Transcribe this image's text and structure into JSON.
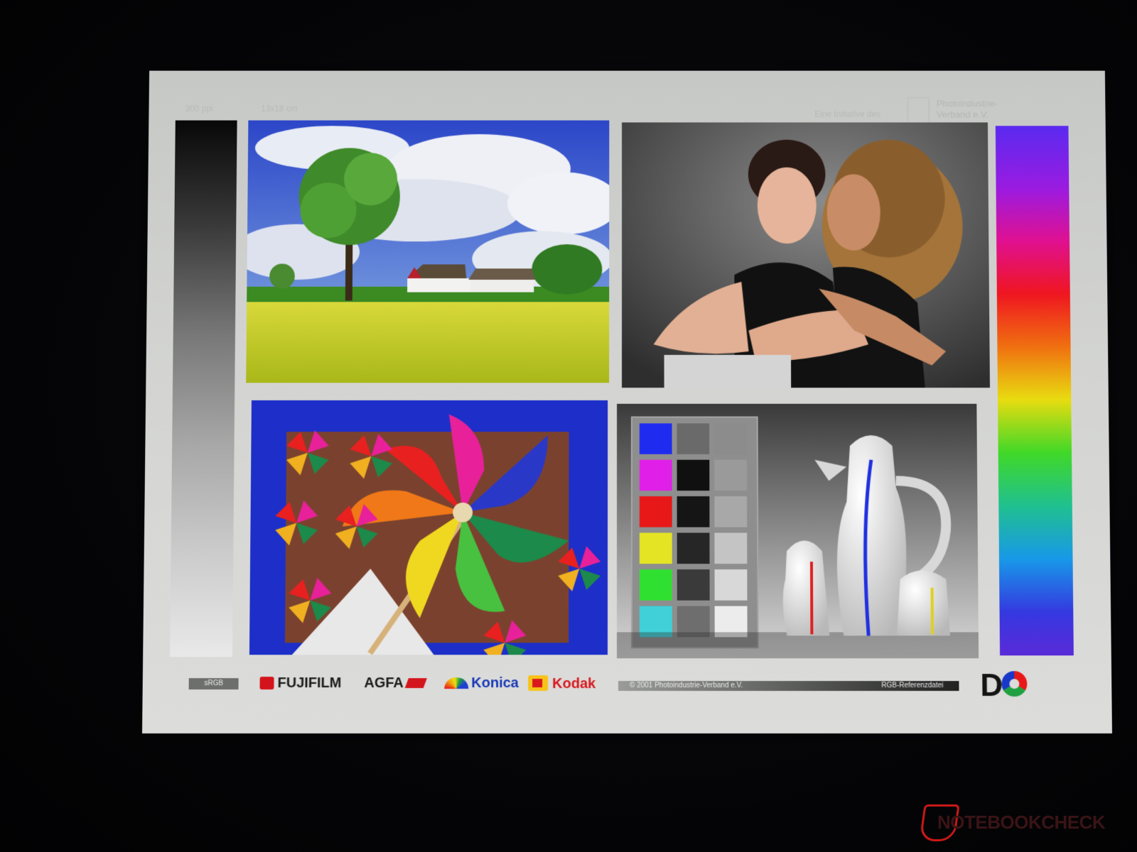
{
  "sheet": {
    "top_left_label_1": "300 ppi",
    "top_left_label_2": "13x18 cm",
    "initiative_label": "Eine Initiative des",
    "publisher_line1": "Photoindustrie-",
    "publisher_line2": "Verband e.V."
  },
  "footer": {
    "srgb_label": "sRGB",
    "brands": [
      "FUJIFILM",
      "AGFA",
      "Konica",
      "Kodak"
    ],
    "copyright": "© 2001  Photoindustrie-Verband e.V.",
    "reference": "RGB-Referenzdatei"
  },
  "color_chart": {
    "left_column": [
      "#1f2cf0",
      "#e020e8",
      "#e81818",
      "#e4e424",
      "#30e030",
      "#40d0d8"
    ],
    "middle_column": [
      "#6a6a6a",
      "#101010",
      "#151515",
      "#262626",
      "#3a3a3a",
      "#6e6e6e"
    ],
    "right_column": [
      "#8c8c8c",
      "#9a9a9a",
      "#a8a8a8",
      "#c4c4c4",
      "#d8d8d8",
      "#ececec"
    ]
  },
  "watermark": {
    "brand": "NOTEBOOKCHECK"
  }
}
